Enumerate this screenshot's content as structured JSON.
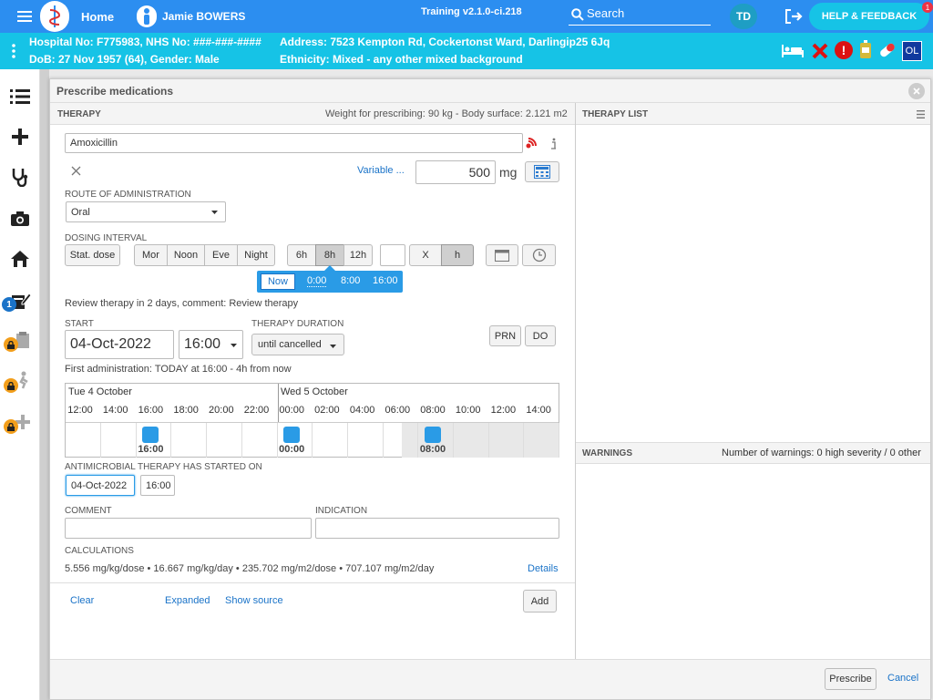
{
  "topbar": {
    "home": "Home",
    "patient_name": "Jamie BOWERS",
    "version": "Training v2.1.0-ci.218",
    "search_placeholder": "Search",
    "avatar": "TD",
    "help": "HELP & FEEDBACK",
    "help_badge": "1"
  },
  "patient": {
    "line1": "Hospital No: F775983, NHS No: ###-###-####",
    "line2": "DoB: 27 Nov 1957 (64), Gender: Male",
    "address": "Address: 7523 Kempton Rd, Cockertonst Ward, Darlingip25 6Jq",
    "ethnicity": "Ethnicity: Mixed - any other mixed background",
    "ol": "OL"
  },
  "sidebar": {
    "badge": "1"
  },
  "dialog": {
    "title": "Prescribe medications",
    "therapy_header": "THERAPY",
    "weight_info": "Weight for prescribing: 90 kg - Body surface: 2.121 m2",
    "therapy_list_header": "THERAPY LIST",
    "warnings_header": "WARNINGS",
    "warnings_info": "Number of warnings: 0 high severity / 0 other",
    "medication": "Amoxicillin",
    "variable_link": "Variable ...",
    "dose_value": "500",
    "dose_unit": "mg",
    "route_label": "ROUTE OF ADMINISTRATION",
    "route_value": "Oral",
    "dosing_label": "DOSING INTERVAL",
    "stat_dose": "Stat. dose",
    "mor": "Mor",
    "noon": "Noon",
    "eve": "Eve",
    "night": "Night",
    "h6": "6h",
    "h8": "8h",
    "h12": "12h",
    "x": "X",
    "h": "h",
    "times": {
      "now": "Now",
      "t1": "0:00",
      "t2": "8:00",
      "t3": "16:00"
    },
    "review_text": "Review therapy in 2 days, comment: Review therapy",
    "start_label": "START",
    "start_date": "04-Oct-2022",
    "start_time": "16:00",
    "duration_label": "THERAPY DURATION",
    "duration_value": "until cancelled",
    "prn": "PRN",
    "do": "DO",
    "first_admin": "First administration: TODAY at 16:00 - 4h from now",
    "timeline": {
      "day1": "Tue 4 October",
      "day2": "Wed 5 October",
      "hours": [
        "12:00",
        "14:00",
        "16:00",
        "18:00",
        "20:00",
        "22:00",
        "00:00",
        "02:00",
        "04:00",
        "06:00",
        "08:00",
        "10:00",
        "12:00",
        "14:00"
      ],
      "doses": [
        "16:00",
        "00:00",
        "08:00"
      ]
    },
    "antimicrobial_label": "ANTIMICROBIAL THERAPY HAS STARTED ON",
    "antimicrobial_date": "04-Oct-2022",
    "antimicrobial_time": "16:00",
    "comment_label": "COMMENT",
    "indication_label": "INDICATION",
    "calculations_label": "CALCULATIONS",
    "calculations": "5.556 mg/kg/dose • 16.667 mg/kg/day • 235.702 mg/m2/dose • 707.107 mg/m2/day",
    "details": "Details",
    "clear": "Clear",
    "expanded": "Expanded",
    "show_source": "Show source",
    "add": "Add",
    "prescribe": "Prescribe",
    "cancel": "Cancel"
  },
  "colors": {
    "topbar": "#2c8ef0",
    "patient_bar": "#16c3e6",
    "accent": "#2a9be6"
  }
}
